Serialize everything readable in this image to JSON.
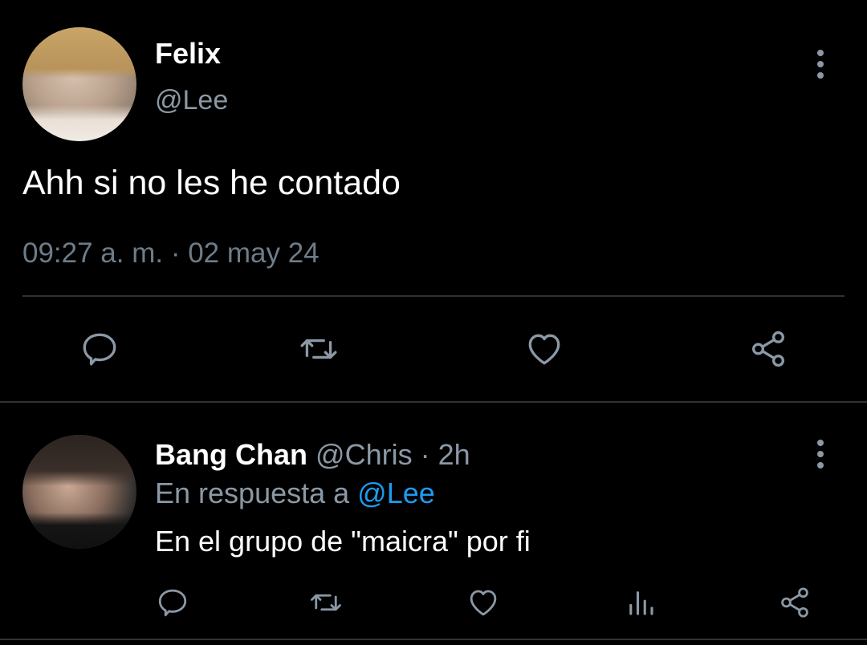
{
  "main_tweet": {
    "display_name": "Felix",
    "handle": "@Lee",
    "text": "Ahh si no les he contado",
    "timestamp": "09:27 a. m. · 02 may 24",
    "actions": [
      "reply-icon",
      "retweet-icon",
      "heart-icon",
      "share-icon"
    ]
  },
  "reply_tweet": {
    "display_name": "Bang Chan",
    "handle": "@Chris",
    "separator": "·",
    "time": "2h",
    "replying_to_prefix": "En respuesta a",
    "replying_to_handle": "@Lee",
    "text": "En el grupo de \"maicra\" por fi",
    "actions": [
      "reply-icon",
      "retweet-icon",
      "heart-icon",
      "stats-icon",
      "share-icon"
    ]
  },
  "colors": {
    "background": "#000000",
    "primary_text": "#ffffff",
    "secondary_text": "#8b98a5",
    "link": "#1d9bf0",
    "divider": "#2f3336"
  }
}
